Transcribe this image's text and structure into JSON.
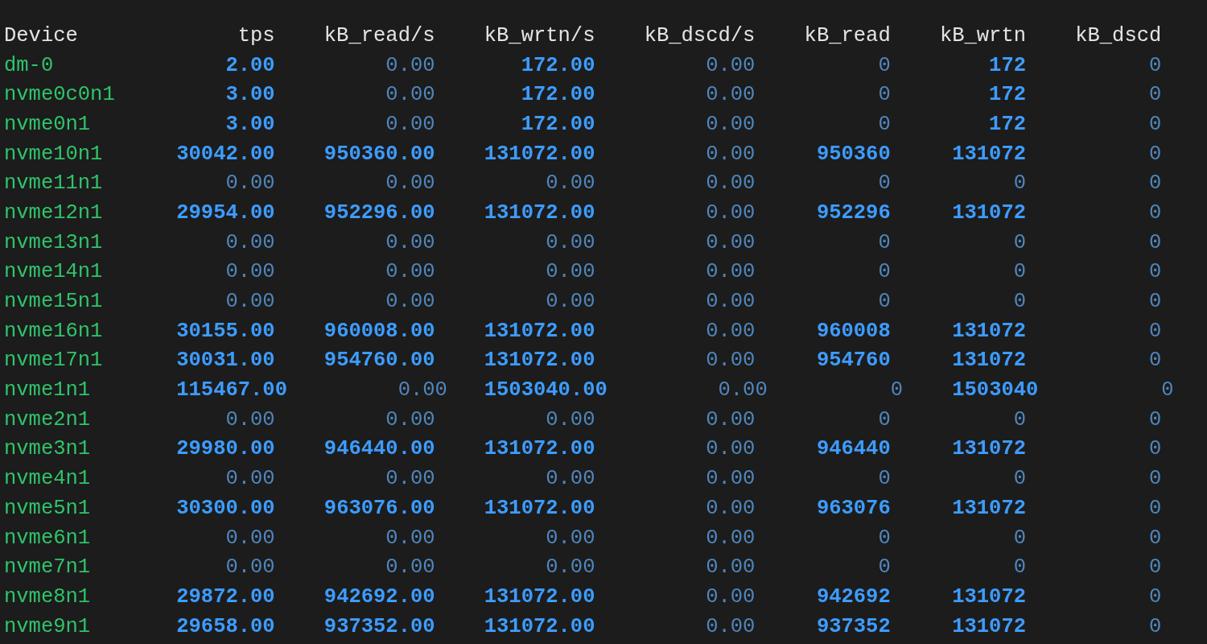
{
  "columns": [
    "Device",
    "tps",
    "kB_read/s",
    "kB_wrtn/s",
    "kB_dscd/s",
    "kB_read",
    "kB_wrtn",
    "kB_dscd"
  ],
  "rows": [
    {
      "device": "dm-0",
      "cells": [
        {
          "text": "2.00",
          "bright": true
        },
        {
          "text": "0.00",
          "bright": false
        },
        {
          "text": "172.00",
          "bright": true
        },
        {
          "text": "0.00",
          "bright": false
        },
        {
          "text": "0",
          "bright": false
        },
        {
          "text": "172",
          "bright": true
        },
        {
          "text": "0",
          "bright": false
        }
      ]
    },
    {
      "device": "nvme0c0n1",
      "cells": [
        {
          "text": "3.00",
          "bright": true
        },
        {
          "text": "0.00",
          "bright": false
        },
        {
          "text": "172.00",
          "bright": true
        },
        {
          "text": "0.00",
          "bright": false
        },
        {
          "text": "0",
          "bright": false
        },
        {
          "text": "172",
          "bright": true
        },
        {
          "text": "0",
          "bright": false
        }
      ]
    },
    {
      "device": "nvme0n1",
      "cells": [
        {
          "text": "3.00",
          "bright": true
        },
        {
          "text": "0.00",
          "bright": false
        },
        {
          "text": "172.00",
          "bright": true
        },
        {
          "text": "0.00",
          "bright": false
        },
        {
          "text": "0",
          "bright": false
        },
        {
          "text": "172",
          "bright": true
        },
        {
          "text": "0",
          "bright": false
        }
      ]
    },
    {
      "device": "nvme10n1",
      "cells": [
        {
          "text": "30042.00",
          "bright": true
        },
        {
          "text": "950360.00",
          "bright": true
        },
        {
          "text": "131072.00",
          "bright": true
        },
        {
          "text": "0.00",
          "bright": false
        },
        {
          "text": "950360",
          "bright": true
        },
        {
          "text": "131072",
          "bright": true
        },
        {
          "text": "0",
          "bright": false
        }
      ]
    },
    {
      "device": "nvme11n1",
      "cells": [
        {
          "text": "0.00",
          "bright": false
        },
        {
          "text": "0.00",
          "bright": false
        },
        {
          "text": "0.00",
          "bright": false
        },
        {
          "text": "0.00",
          "bright": false
        },
        {
          "text": "0",
          "bright": false
        },
        {
          "text": "0",
          "bright": false
        },
        {
          "text": "0",
          "bright": false
        }
      ]
    },
    {
      "device": "nvme12n1",
      "cells": [
        {
          "text": "29954.00",
          "bright": true
        },
        {
          "text": "952296.00",
          "bright": true
        },
        {
          "text": "131072.00",
          "bright": true
        },
        {
          "text": "0.00",
          "bright": false
        },
        {
          "text": "952296",
          "bright": true
        },
        {
          "text": "131072",
          "bright": true
        },
        {
          "text": "0",
          "bright": false
        }
      ]
    },
    {
      "device": "nvme13n1",
      "cells": [
        {
          "text": "0.00",
          "bright": false
        },
        {
          "text": "0.00",
          "bright": false
        },
        {
          "text": "0.00",
          "bright": false
        },
        {
          "text": "0.00",
          "bright": false
        },
        {
          "text": "0",
          "bright": false
        },
        {
          "text": "0",
          "bright": false
        },
        {
          "text": "0",
          "bright": false
        }
      ]
    },
    {
      "device": "nvme14n1",
      "cells": [
        {
          "text": "0.00",
          "bright": false
        },
        {
          "text": "0.00",
          "bright": false
        },
        {
          "text": "0.00",
          "bright": false
        },
        {
          "text": "0.00",
          "bright": false
        },
        {
          "text": "0",
          "bright": false
        },
        {
          "text": "0",
          "bright": false
        },
        {
          "text": "0",
          "bright": false
        }
      ]
    },
    {
      "device": "nvme15n1",
      "cells": [
        {
          "text": "0.00",
          "bright": false
        },
        {
          "text": "0.00",
          "bright": false
        },
        {
          "text": "0.00",
          "bright": false
        },
        {
          "text": "0.00",
          "bright": false
        },
        {
          "text": "0",
          "bright": false
        },
        {
          "text": "0",
          "bright": false
        },
        {
          "text": "0",
          "bright": false
        }
      ]
    },
    {
      "device": "nvme16n1",
      "cells": [
        {
          "text": "30155.00",
          "bright": true
        },
        {
          "text": "960008.00",
          "bright": true
        },
        {
          "text": "131072.00",
          "bright": true
        },
        {
          "text": "0.00",
          "bright": false
        },
        {
          "text": "960008",
          "bright": true
        },
        {
          "text": "131072",
          "bright": true
        },
        {
          "text": "0",
          "bright": false
        }
      ]
    },
    {
      "device": "nvme17n1",
      "cells": [
        {
          "text": "30031.00",
          "bright": true
        },
        {
          "text": "954760.00",
          "bright": true
        },
        {
          "text": "131072.00",
          "bright": true
        },
        {
          "text": "0.00",
          "bright": false
        },
        {
          "text": "954760",
          "bright": true
        },
        {
          "text": "131072",
          "bright": true
        },
        {
          "text": "0",
          "bright": false
        }
      ]
    },
    {
      "device": "nvme1n1",
      "cells": [
        {
          "text": "115467.00",
          "bright": true
        },
        {
          "text": "0.00",
          "bright": false
        },
        {
          "text": "1503040.00",
          "bright": true
        },
        {
          "text": "0.00",
          "bright": false
        },
        {
          "text": "0",
          "bright": false
        },
        {
          "text": "1503040",
          "bright": true
        },
        {
          "text": "0",
          "bright": false
        }
      ]
    },
    {
      "device": "nvme2n1",
      "cells": [
        {
          "text": "0.00",
          "bright": false
        },
        {
          "text": "0.00",
          "bright": false
        },
        {
          "text": "0.00",
          "bright": false
        },
        {
          "text": "0.00",
          "bright": false
        },
        {
          "text": "0",
          "bright": false
        },
        {
          "text": "0",
          "bright": false
        },
        {
          "text": "0",
          "bright": false
        }
      ]
    },
    {
      "device": "nvme3n1",
      "cells": [
        {
          "text": "29980.00",
          "bright": true
        },
        {
          "text": "946440.00",
          "bright": true
        },
        {
          "text": "131072.00",
          "bright": true
        },
        {
          "text": "0.00",
          "bright": false
        },
        {
          "text": "946440",
          "bright": true
        },
        {
          "text": "131072",
          "bright": true
        },
        {
          "text": "0",
          "bright": false
        }
      ]
    },
    {
      "device": "nvme4n1",
      "cells": [
        {
          "text": "0.00",
          "bright": false
        },
        {
          "text": "0.00",
          "bright": false
        },
        {
          "text": "0.00",
          "bright": false
        },
        {
          "text": "0.00",
          "bright": false
        },
        {
          "text": "0",
          "bright": false
        },
        {
          "text": "0",
          "bright": false
        },
        {
          "text": "0",
          "bright": false
        }
      ]
    },
    {
      "device": "nvme5n1",
      "cells": [
        {
          "text": "30300.00",
          "bright": true
        },
        {
          "text": "963076.00",
          "bright": true
        },
        {
          "text": "131072.00",
          "bright": true
        },
        {
          "text": "0.00",
          "bright": false
        },
        {
          "text": "963076",
          "bright": true
        },
        {
          "text": "131072",
          "bright": true
        },
        {
          "text": "0",
          "bright": false
        }
      ]
    },
    {
      "device": "nvme6n1",
      "cells": [
        {
          "text": "0.00",
          "bright": false
        },
        {
          "text": "0.00",
          "bright": false
        },
        {
          "text": "0.00",
          "bright": false
        },
        {
          "text": "0.00",
          "bright": false
        },
        {
          "text": "0",
          "bright": false
        },
        {
          "text": "0",
          "bright": false
        },
        {
          "text": "0",
          "bright": false
        }
      ]
    },
    {
      "device": "nvme7n1",
      "cells": [
        {
          "text": "0.00",
          "bright": false
        },
        {
          "text": "0.00",
          "bright": false
        },
        {
          "text": "0.00",
          "bright": false
        },
        {
          "text": "0.00",
          "bright": false
        },
        {
          "text": "0",
          "bright": false
        },
        {
          "text": "0",
          "bright": false
        },
        {
          "text": "0",
          "bright": false
        }
      ]
    },
    {
      "device": "nvme8n1",
      "cells": [
        {
          "text": "29872.00",
          "bright": true
        },
        {
          "text": "942692.00",
          "bright": true
        },
        {
          "text": "131072.00",
          "bright": true
        },
        {
          "text": "0.00",
          "bright": false
        },
        {
          "text": "942692",
          "bright": true
        },
        {
          "text": "131072",
          "bright": true
        },
        {
          "text": "0",
          "bright": false
        }
      ]
    },
    {
      "device": "nvme9n1",
      "cells": [
        {
          "text": "29658.00",
          "bright": true
        },
        {
          "text": "937352.00",
          "bright": true
        },
        {
          "text": "131072.00",
          "bright": true
        },
        {
          "text": "0.00",
          "bright": false
        },
        {
          "text": "937352",
          "bright": true
        },
        {
          "text": "131072",
          "bright": true
        },
        {
          "text": "0",
          "bright": false
        }
      ]
    }
  ]
}
